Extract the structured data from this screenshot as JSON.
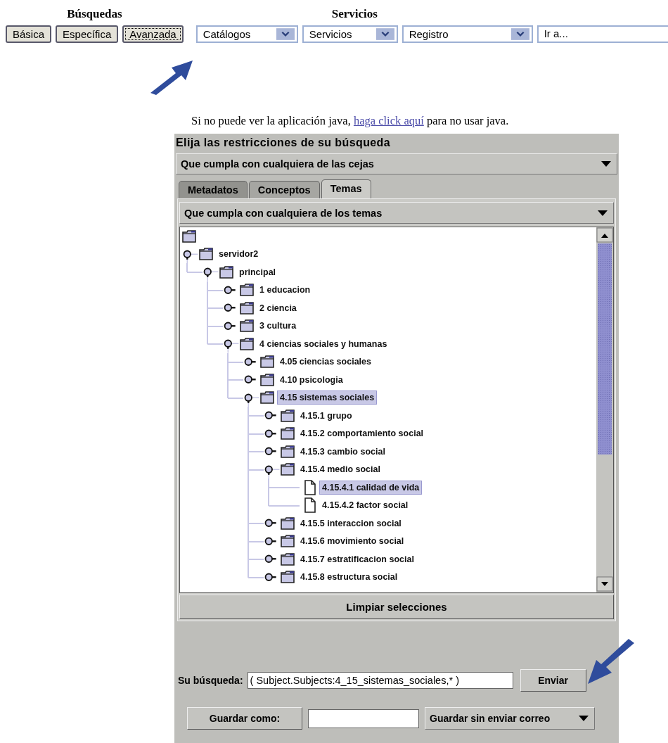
{
  "searches": {
    "title": "Búsquedas",
    "buttons": [
      {
        "label": "Básica",
        "focused": false
      },
      {
        "label": "Específica",
        "focused": false
      },
      {
        "label": "Avanzada",
        "focused": true
      }
    ]
  },
  "services": {
    "title": "Servicios",
    "controls": [
      {
        "kind": "dropdown",
        "value": "Catálogos"
      },
      {
        "kind": "dropdown",
        "value": "Servicios"
      },
      {
        "kind": "dropdown",
        "value": "Registro"
      },
      {
        "kind": "field",
        "value": "Ir a..."
      }
    ]
  },
  "notice": {
    "before": "Si no puede ver la aplicación java, ",
    "link": "haga click aquí",
    "after": " para no usar java."
  },
  "applet": {
    "title": "Elija las restricciones de su búsqueda",
    "scope_select": "Que cumpla con cualquiera de las cejas",
    "tabs": [
      {
        "label": "Metadatos",
        "selected": false
      },
      {
        "label": "Conceptos",
        "selected": false
      },
      {
        "label": "Temas",
        "selected": true
      }
    ],
    "topic_select": "Que cumpla con cualquiera de los temas",
    "tree": [
      {
        "kind": "folder",
        "children": [
          {
            "kind": "folder",
            "label": "servidor2",
            "expanded": true,
            "selected": false,
            "children": [
              {
                "kind": "folder",
                "label": "principal",
                "expanded": true,
                "selected": false,
                "children": [
                  {
                    "kind": "folder",
                    "label": "1 educacion",
                    "expanded": false,
                    "selected": false
                  },
                  {
                    "kind": "folder",
                    "label": "2 ciencia",
                    "expanded": false,
                    "selected": false
                  },
                  {
                    "kind": "folder",
                    "label": "3 cultura",
                    "expanded": false,
                    "selected": false
                  },
                  {
                    "kind": "folder",
                    "label": "4 ciencias sociales y humanas",
                    "expanded": true,
                    "selected": false,
                    "children": [
                      {
                        "kind": "folder",
                        "label": "4.05 ciencias sociales",
                        "expanded": false,
                        "selected": false
                      },
                      {
                        "kind": "folder",
                        "label": "4.10 psicologia",
                        "expanded": false,
                        "selected": false
                      },
                      {
                        "kind": "folder",
                        "label": "4.15 sistemas sociales",
                        "expanded": true,
                        "selected": true,
                        "children": [
                          {
                            "kind": "folder",
                            "label": "4.15.1 grupo",
                            "expanded": false,
                            "selected": false
                          },
                          {
                            "kind": "folder",
                            "label": "4.15.2 comportamiento social",
                            "expanded": false,
                            "selected": false
                          },
                          {
                            "kind": "folder",
                            "label": "4.15.3 cambio social",
                            "expanded": false,
                            "selected": false
                          },
                          {
                            "kind": "folder",
                            "label": "4.15.4 medio social",
                            "expanded": true,
                            "selected": false,
                            "children": [
                              {
                                "kind": "file",
                                "label": "4.15.4.1 calidad de vida",
                                "selected": true
                              },
                              {
                                "kind": "file",
                                "label": "4.15.4.2 factor social",
                                "selected": false
                              }
                            ]
                          },
                          {
                            "kind": "folder",
                            "label": "4.15.5 interaccion social",
                            "expanded": false,
                            "selected": false
                          },
                          {
                            "kind": "folder",
                            "label": "4.15.6 movimiento social",
                            "expanded": false,
                            "selected": false
                          },
                          {
                            "kind": "folder",
                            "label": "4.15.7 estratificacion social",
                            "expanded": false,
                            "selected": false
                          },
                          {
                            "kind": "folder",
                            "label": "4.15.8 estructura social",
                            "expanded": false,
                            "selected": false
                          }
                        ]
                      }
                    ]
                  }
                ]
              }
            ]
          }
        ]
      }
    ],
    "clear_button": "Limpiar selecciones",
    "query_label": "Su búsqueda:",
    "query_value": "( Subject.Subjects:4_15_sistemas_sociales,* )",
    "send_button": "Enviar",
    "save_button": "Guardar como:",
    "save_mode_select": "Guardar sin enviar correo"
  }
}
